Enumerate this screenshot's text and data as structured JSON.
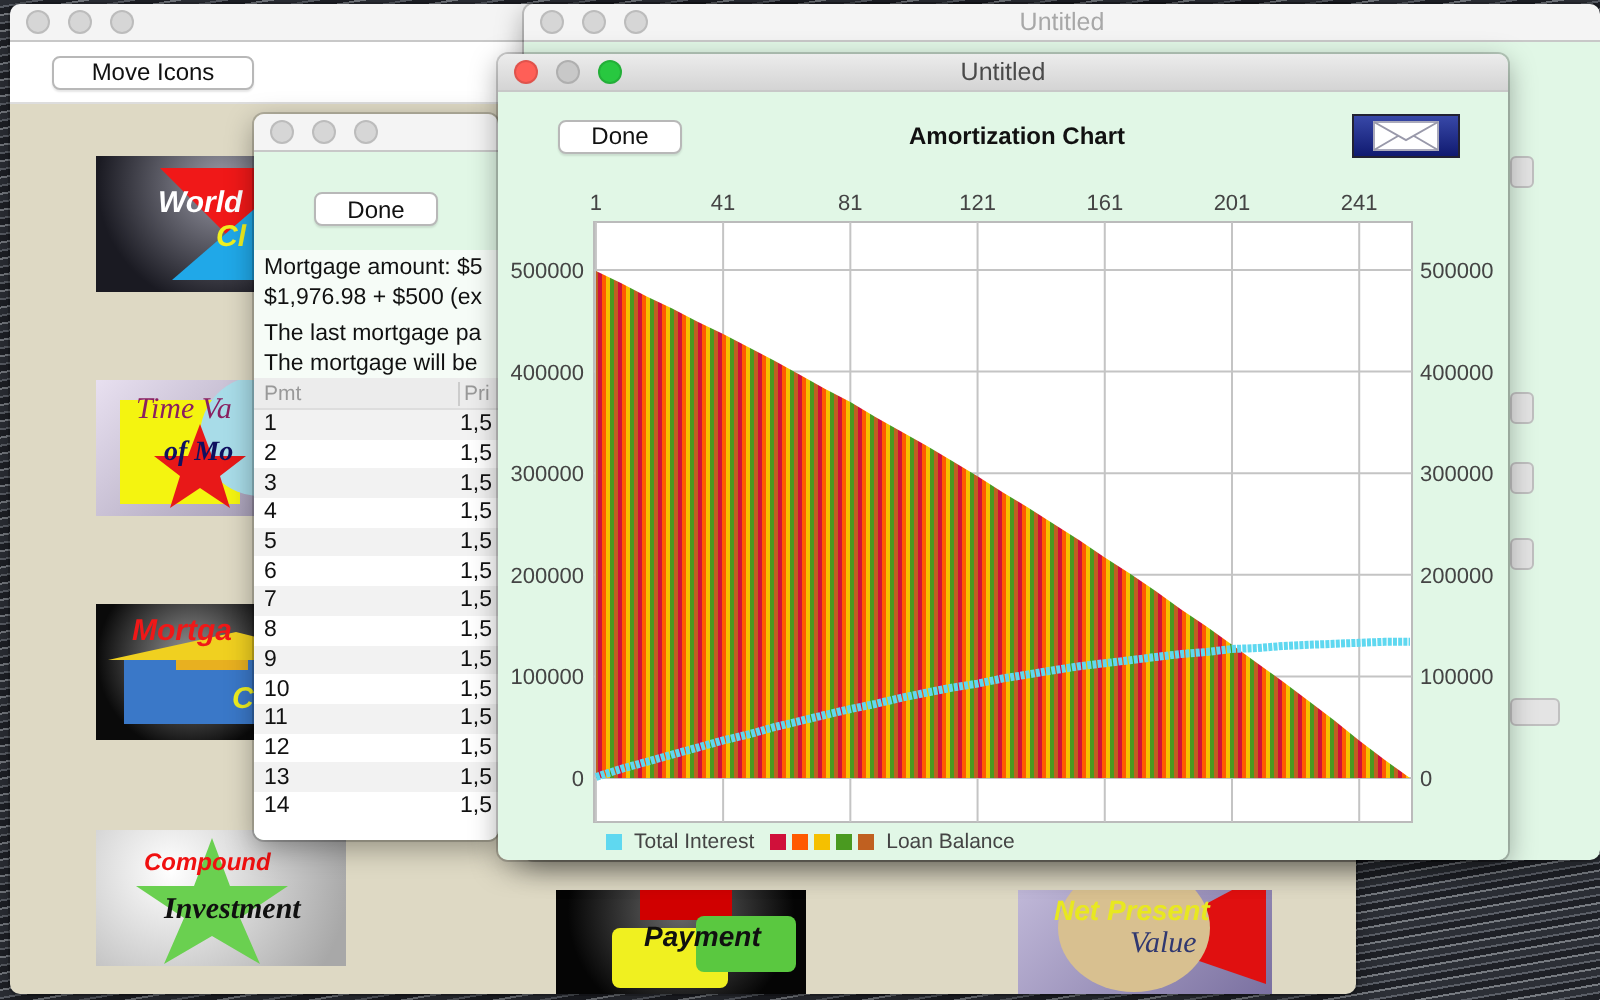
{
  "windows": [
    {
      "kind": "icons",
      "active": false,
      "toolbar_button": "Move Icons",
      "icons": [
        {
          "kind": "world_clock",
          "labels": [
            "World",
            "Cl"
          ]
        },
        {
          "kind": "time_value",
          "labels": [
            "Time Va",
            "of Mo"
          ]
        },
        {
          "kind": "mortgage",
          "labels": [
            "Mortga",
            "C"
          ]
        },
        {
          "kind": "compound",
          "labels": [
            "Compound",
            "Investment"
          ]
        },
        {
          "kind": "payment",
          "labels": [
            "Payment"
          ]
        },
        {
          "kind": "npv",
          "labels": [
            "Net Present",
            "Value"
          ]
        }
      ]
    },
    {
      "kind": "form",
      "active": false,
      "title": "Untitled"
    },
    {
      "kind": "schedule",
      "active": false,
      "done_button": "Done",
      "summary": [
        "Mortgage amount: $5",
        "$1,976.98 + $500 (ex"
      ],
      "notes": [
        "The last mortgage pa",
        "The mortgage will be"
      ],
      "table": {
        "columns": [
          "Pmt",
          "Pri"
        ],
        "rows": [
          [
            "1",
            "1,5"
          ],
          [
            "2",
            "1,5"
          ],
          [
            "3",
            "1,5"
          ],
          [
            "4",
            "1,5"
          ],
          [
            "5",
            "1,5"
          ],
          [
            "6",
            "1,5"
          ],
          [
            "7",
            "1,5"
          ],
          [
            "8",
            "1,5"
          ],
          [
            "9",
            "1,5"
          ],
          [
            "10",
            "1,5"
          ],
          [
            "11",
            "1,5"
          ],
          [
            "12",
            "1,5"
          ],
          [
            "13",
            "1,5"
          ],
          [
            "14",
            "1,5"
          ]
        ]
      }
    },
    {
      "kind": "chart",
      "active": true,
      "title": "Untitled",
      "done_button": "Done",
      "heading": "Amortization Chart",
      "left_axis_labels": [
        "500000",
        "400000",
        "300000",
        "200000",
        "100000",
        "0"
      ],
      "balance_swatches": [
        {
          "color": "#ff5a00"
        },
        {
          "color": "#f5c000"
        },
        {
          "color": "#4a9a20"
        },
        {
          "color": "#c06020"
        }
      ],
      "chart_data": {
        "type": "area",
        "grid": true,
        "x": [
          1,
          9,
          17,
          25,
          33,
          41,
          49,
          57,
          65,
          73,
          81,
          89,
          97,
          105,
          113,
          121,
          129,
          137,
          145,
          153,
          161,
          169,
          177,
          185,
          193,
          201,
          209,
          217,
          225,
          233,
          241,
          249,
          257
        ],
        "xlim": [
          0.4,
          257.6
        ],
        "ylim": [
          -43300,
          547200
        ],
        "xticks": [
          1,
          41,
          81,
          121,
          161,
          201,
          241
        ],
        "yticks": [
          0,
          100000,
          200000,
          300000,
          400000,
          500000
        ],
        "series": [
          {
            "name": "Total Interest",
            "type": "line",
            "line_style": "dotted",
            "color": "#5fd8f0",
            "values": [
              1000,
              9000,
              16000,
              23000,
              30000,
              37000,
              43000,
              50000,
              56000,
              62000,
              68000,
              73000,
              79000,
              84000,
              89000,
              93000,
              98000,
              102000,
              106000,
              110000,
              113000,
              116000,
              119000,
              122000,
              124000,
              127000,
              128000,
              130000,
              131000,
              132000,
              133000,
              134000,
              134000
            ]
          },
          {
            "name": "Loan Balance",
            "color": "#d0103a",
            "values": [
              499000,
              487000,
              474000,
              462000,
              449000,
              437000,
              424000,
              411000,
              397000,
              383000,
              370000,
              355000,
              341000,
              327000,
              312000,
              297000,
              281000,
              266000,
              250000,
              234000,
              217000,
              201000,
              184000,
              166000,
              149000,
              131000,
              113000,
              95000,
              76000,
              57000,
              37000,
              18000,
              0
            ]
          }
        ]
      }
    }
  ]
}
